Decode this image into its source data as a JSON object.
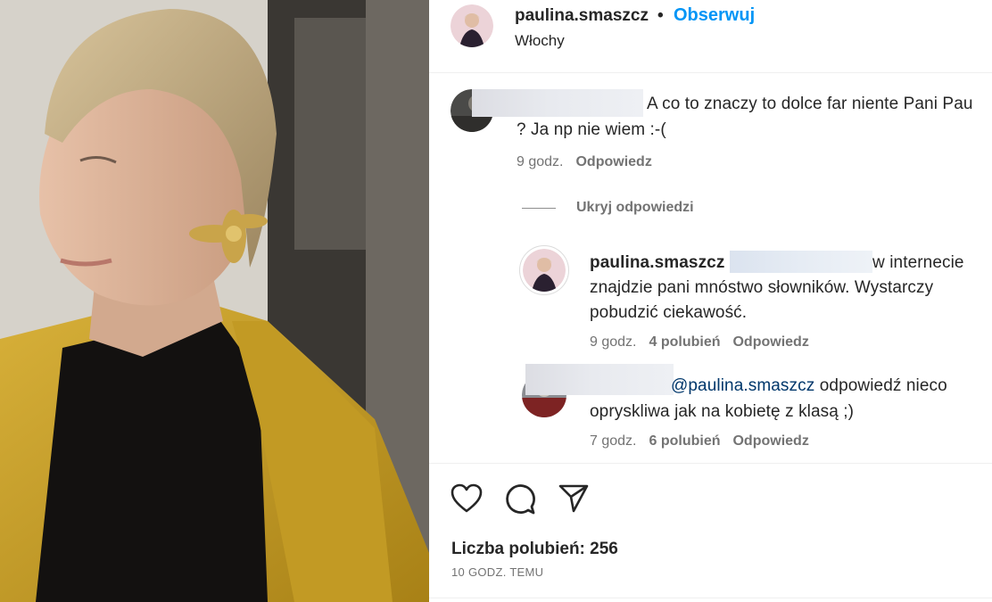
{
  "post": {
    "photo_alt": "",
    "author": {
      "username": "paulina.smaszcz",
      "separator": "•",
      "follow_label": "Obserwuj",
      "location": "Włochy"
    },
    "comments": [
      {
        "text_line1": "A co to znaczy to dolce far niente Pani Pau",
        "text_line2": "? Ja np nie wiem :-(",
        "time": "9 godz.",
        "reply_label": "Odpowiedz",
        "hide_replies_label": "Ukryj odpowiedzi",
        "replies": [
          {
            "username": "paulina.smaszcz",
            "text_line1": "w internecie",
            "text_line2": "znajdzie pani mnóstwo słowników. Wystarczy",
            "text_line3": "pobudzić ciekawość.",
            "time": "9 godz.",
            "likes": "4 polubień",
            "reply_label": "Odpowiedz"
          },
          {
            "mention": "@paulina.smaszcz",
            "text_line1": "odpowiedź nieco",
            "text_line2": "opryskliwa jak na kobietę z klasą ;)",
            "time": "7 godz.",
            "likes": "6 polubień",
            "reply_label": "Odpowiedz"
          }
        ]
      }
    ],
    "actions": {
      "like_icon": "heart-icon",
      "comment_icon": "comment-icon",
      "share_icon": "share-icon"
    },
    "likes_summary": "Liczba polubień: 256",
    "posted_ago": "10 GODZ. TEMU"
  },
  "colors": {
    "accent": "#0095f6",
    "text": "#262626",
    "secondary": "#737373",
    "mention": "#00376b",
    "jacket": "#c9a12a"
  }
}
